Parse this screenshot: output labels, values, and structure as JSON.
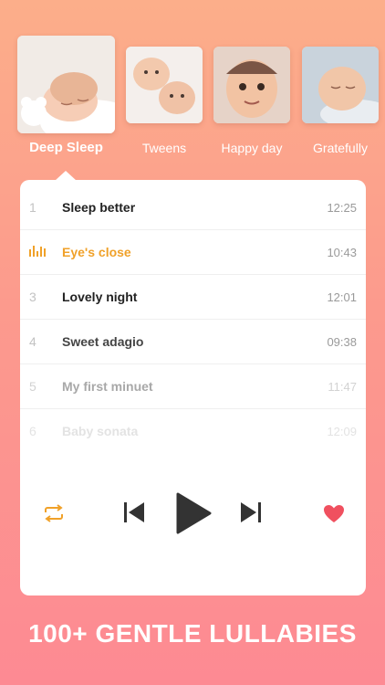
{
  "categories": [
    {
      "label": "Deep Sleep",
      "active": true
    },
    {
      "label": "Tweens",
      "active": false
    },
    {
      "label": "Happy day",
      "active": false
    },
    {
      "label": "Gratefully",
      "active": false
    }
  ],
  "tracks": [
    {
      "number": "1",
      "title": "Sleep better",
      "duration": "12:25"
    },
    {
      "number": "",
      "title": "Eye's close",
      "duration": "10:43",
      "playing": true
    },
    {
      "number": "3",
      "title": "Lovely night",
      "duration": "12:01"
    },
    {
      "number": "4",
      "title": "Sweet adagio",
      "duration": "09:38"
    },
    {
      "number": "5",
      "title": "My first minuet",
      "duration": "11:47"
    },
    {
      "number": "6",
      "title": "Baby sonata",
      "duration": "12:09"
    }
  ],
  "controls": {
    "icons": [
      "repeat-icon",
      "previous-icon",
      "play-icon",
      "next-icon",
      "heart-icon"
    ],
    "accent_color": "#f0a129",
    "heart_color": "#f0505f"
  },
  "footer": {
    "headline": "100+ GENTLE LULLABIES"
  }
}
